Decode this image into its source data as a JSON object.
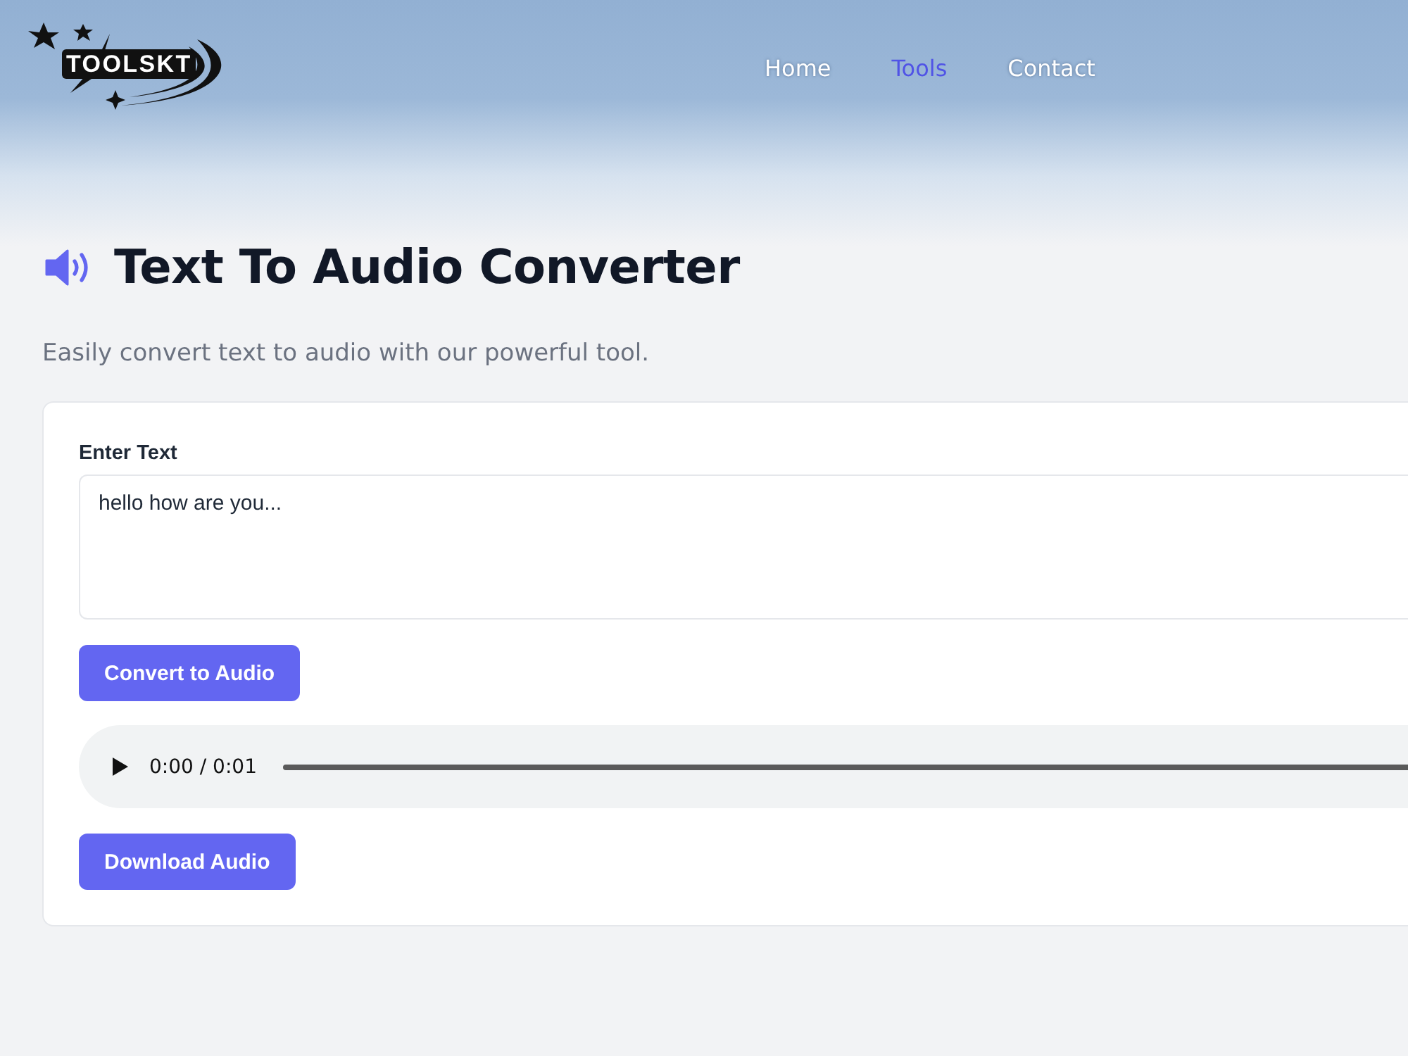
{
  "header": {
    "logo": {
      "text": "TOOLSKT"
    },
    "nav": [
      {
        "label": "Home",
        "selected": false
      },
      {
        "label": "Tools",
        "selected": true
      },
      {
        "label": "Contact",
        "selected": false
      }
    ]
  },
  "page": {
    "title": "Text To Audio Converter",
    "subtitle": "Easily convert text to audio with our powerful tool."
  },
  "form": {
    "label": "Enter Text",
    "textarea": {
      "value": "hello how are you..."
    },
    "convert_button": "Convert to Audio",
    "audio_player": {
      "time": "0:00 / 0:01"
    },
    "download_button": "Download Audio"
  }
}
